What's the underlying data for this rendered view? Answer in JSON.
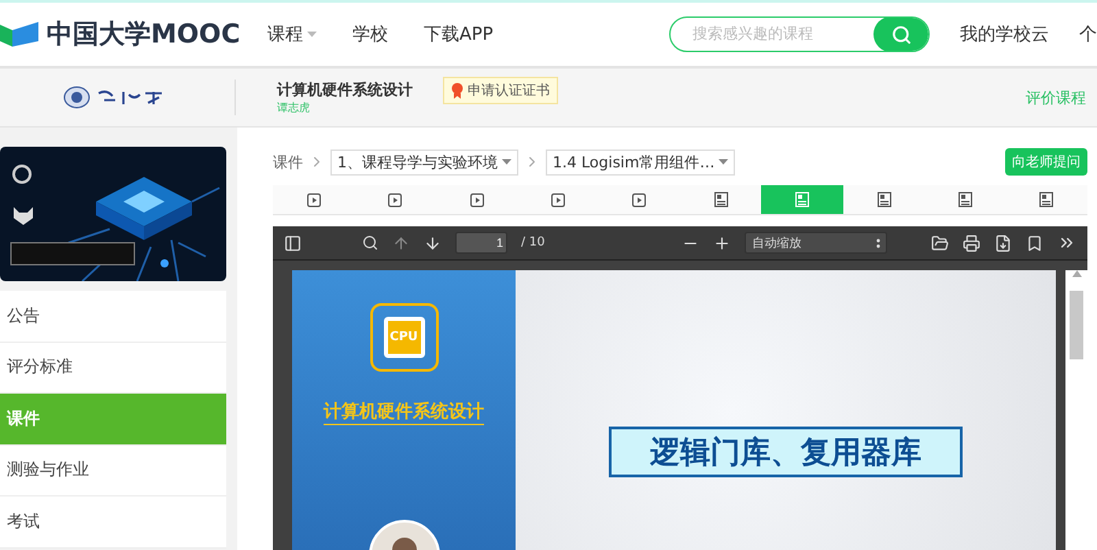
{
  "header": {
    "logo": "中国大学MOOC",
    "nav": [
      {
        "label": "课程",
        "dropdown": true
      },
      {
        "label": "学校",
        "dropdown": false
      },
      {
        "label": "下载APP",
        "dropdown": false
      }
    ],
    "search": {
      "placeholder": "搜索感兴趣的课程"
    },
    "right_links": [
      "我的学校云",
      "个"
    ]
  },
  "course_bar": {
    "course_title": "计算机硬件系统设计",
    "teacher": "谭志虎",
    "certificate": "申请认证证书",
    "rate_link": "评价课程"
  },
  "sidebar": {
    "items": [
      {
        "label": "公告",
        "selected": false
      },
      {
        "label": "评分标准",
        "selected": false
      },
      {
        "label": "课件",
        "selected": true
      },
      {
        "label": "测验与作业",
        "selected": false
      },
      {
        "label": "考试",
        "selected": false
      }
    ]
  },
  "breadcrumb": {
    "root": "课件",
    "chapter": "1、课程导学与实验环境",
    "lesson": "1.4 Logisim常用组件…"
  },
  "ask_button": "向老师提问",
  "unit_tabs": [
    {
      "kind": "video",
      "selected": false
    },
    {
      "kind": "video",
      "selected": false
    },
    {
      "kind": "video",
      "selected": false
    },
    {
      "kind": "video",
      "selected": false
    },
    {
      "kind": "video",
      "selected": false
    },
    {
      "kind": "document",
      "selected": false
    },
    {
      "kind": "document",
      "selected": true
    },
    {
      "kind": "document",
      "selected": false
    },
    {
      "kind": "document",
      "selected": false
    },
    {
      "kind": "document",
      "selected": false
    }
  ],
  "pdf_viewer": {
    "page": "1",
    "page_count": "/ 10",
    "zoom": "自动缩放"
  },
  "slide": {
    "chip_label": "CPU",
    "course_title": "计算机硬件系统设计",
    "heading": "逻辑门库、复用器库"
  }
}
